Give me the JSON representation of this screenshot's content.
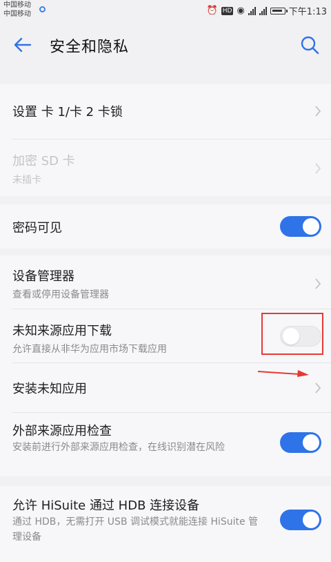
{
  "status": {
    "carrier1": "中国移动",
    "carrier2": "中国移动",
    "hd": "HD",
    "time": "下午1:13",
    "icons": [
      "alarm-icon",
      "hd-icon",
      "eye-icon",
      "signal-icon",
      "signal-icon",
      "battery-icon"
    ]
  },
  "header": {
    "title": "安全和隐私",
    "back_icon": "back-arrow-icon",
    "search_icon": "search-icon"
  },
  "items": {
    "sim_lock": {
      "label": "设置 卡 1/卡 2 卡锁"
    },
    "sd_encrypt": {
      "label": "加密 SD 卡",
      "sub": "未插卡"
    },
    "password_visible": {
      "label": "密码可见",
      "toggle": "on"
    },
    "device_admin": {
      "label": "设备管理器",
      "sub": "查看或停用设备管理器"
    },
    "unknown_sources": {
      "label": "未知来源应用下载",
      "sub": "允许直接从非华为应用市场下载应用",
      "toggle": "off"
    },
    "install_unknown": {
      "label": "安装未知应用"
    },
    "external_check": {
      "label": "外部来源应用检查",
      "sub": "安装前进行外部来源应用检查，在线识别潜在风险",
      "toggle": "on"
    },
    "hisuite": {
      "label": "允许 HiSuite 通过 HDB 连接设备",
      "sub": "通过 HDB，无需打开 USB 调试模式就能连接 HiSuite 管理设备",
      "toggle": "on"
    }
  },
  "colors": {
    "accent": "#2f73e8",
    "annotation": "#e53935"
  }
}
